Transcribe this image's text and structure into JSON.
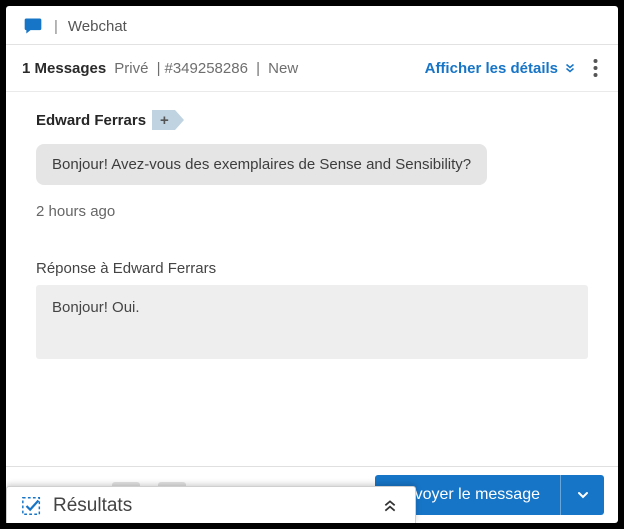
{
  "channel": {
    "name": "Webchat"
  },
  "header": {
    "count_label": "1 Messages",
    "privacy": "Privé",
    "ticket_id": "#349258286",
    "status": "New",
    "details_label": "Afficher les détails"
  },
  "thread": {
    "sender": "Edward Ferrars",
    "add_label": "+",
    "message": "Bonjour! Avez-vous des exemplaires de Sense and Sensibility?",
    "timestamp": "2 hours ago"
  },
  "reply": {
    "label": "Réponse à Edward Ferrars",
    "draft": "Bonjour! Oui."
  },
  "actions": {
    "send": "Envoyer le message"
  },
  "results": {
    "label": "Résultats"
  }
}
